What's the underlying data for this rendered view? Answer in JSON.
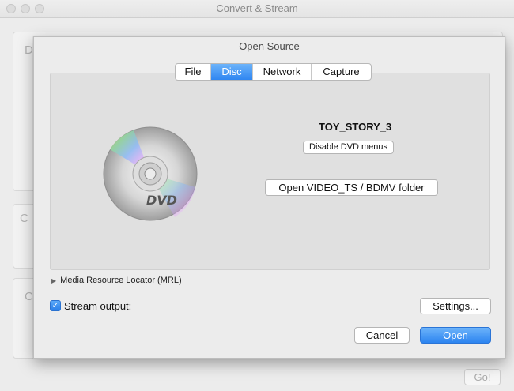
{
  "window": {
    "title": "Convert & Stream",
    "go_label": "Go!"
  },
  "background": {
    "letter_1": "D",
    "letter_2": "C",
    "letter_3": "C"
  },
  "sheet": {
    "title": "Open Source",
    "tabs": [
      {
        "label": "File",
        "active": false
      },
      {
        "label": "Disc",
        "active": true
      },
      {
        "label": "Network",
        "active": false
      },
      {
        "label": "Capture",
        "active": false
      }
    ],
    "disc": {
      "icon": "dvd-disc-icon",
      "icon_label": "DVD",
      "name": "TOY_STORY_3",
      "disable_menus_label": "Disable DVD menus",
      "open_folder_label": "Open VIDEO_TS / BDMV folder"
    },
    "mrl_label": "Media Resource Locator (MRL)",
    "stream_output": {
      "label": "Stream output:",
      "checked": true
    },
    "settings_label": "Settings...",
    "cancel_label": "Cancel",
    "open_label": "Open"
  }
}
